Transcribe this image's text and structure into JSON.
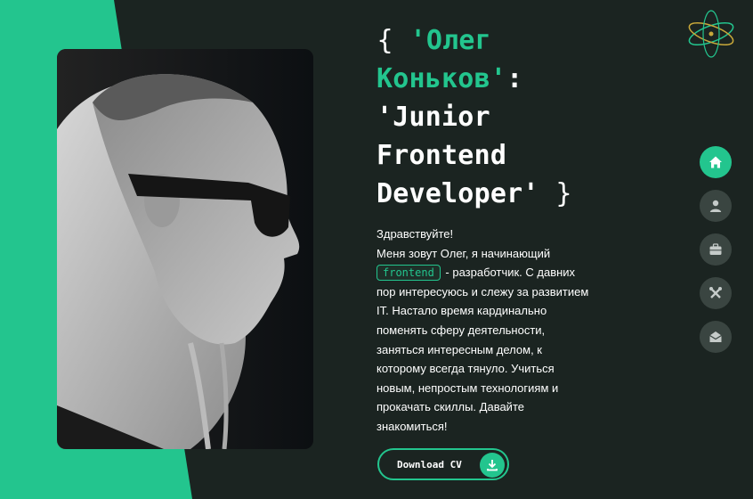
{
  "hero": {
    "title_open": "{",
    "title_name_line1": "'Олег",
    "title_name_line2": "Коньков'",
    "title_colon": ":",
    "title_role_line1": "'Junior",
    "title_role_line2": "Frontend",
    "title_role_line3": "Developer'",
    "title_close": "}"
  },
  "intro": {
    "greeting": "Здравствуйте!",
    "line1": "Меня зовут Олег, я начинающий",
    "chip": "frontend",
    "after_chip": "- разработчик. С давних пор интересуюсь и слежу за развитием IT. Настало время кардинально поменять сферу деятельности, заняться интересным делом, к которому всегда тянуло. Учиться новым, непростым технологиям и прокачать скиллы. Давайте знакомиться!"
  },
  "cv_button": {
    "label": "Download CV",
    "icon": "download-icon"
  },
  "nav": {
    "items": [
      {
        "icon": "home-icon",
        "active": true
      },
      {
        "icon": "user-icon",
        "active": false
      },
      {
        "icon": "briefcase-icon",
        "active": false
      },
      {
        "icon": "tools-icon",
        "active": false
      },
      {
        "icon": "mail-icon",
        "active": false
      }
    ]
  },
  "colors": {
    "accent": "#23c58e",
    "background": "#1b2421",
    "nav_inactive": "#3a4541"
  },
  "logo": {
    "icon": "atom-logo-icon"
  }
}
